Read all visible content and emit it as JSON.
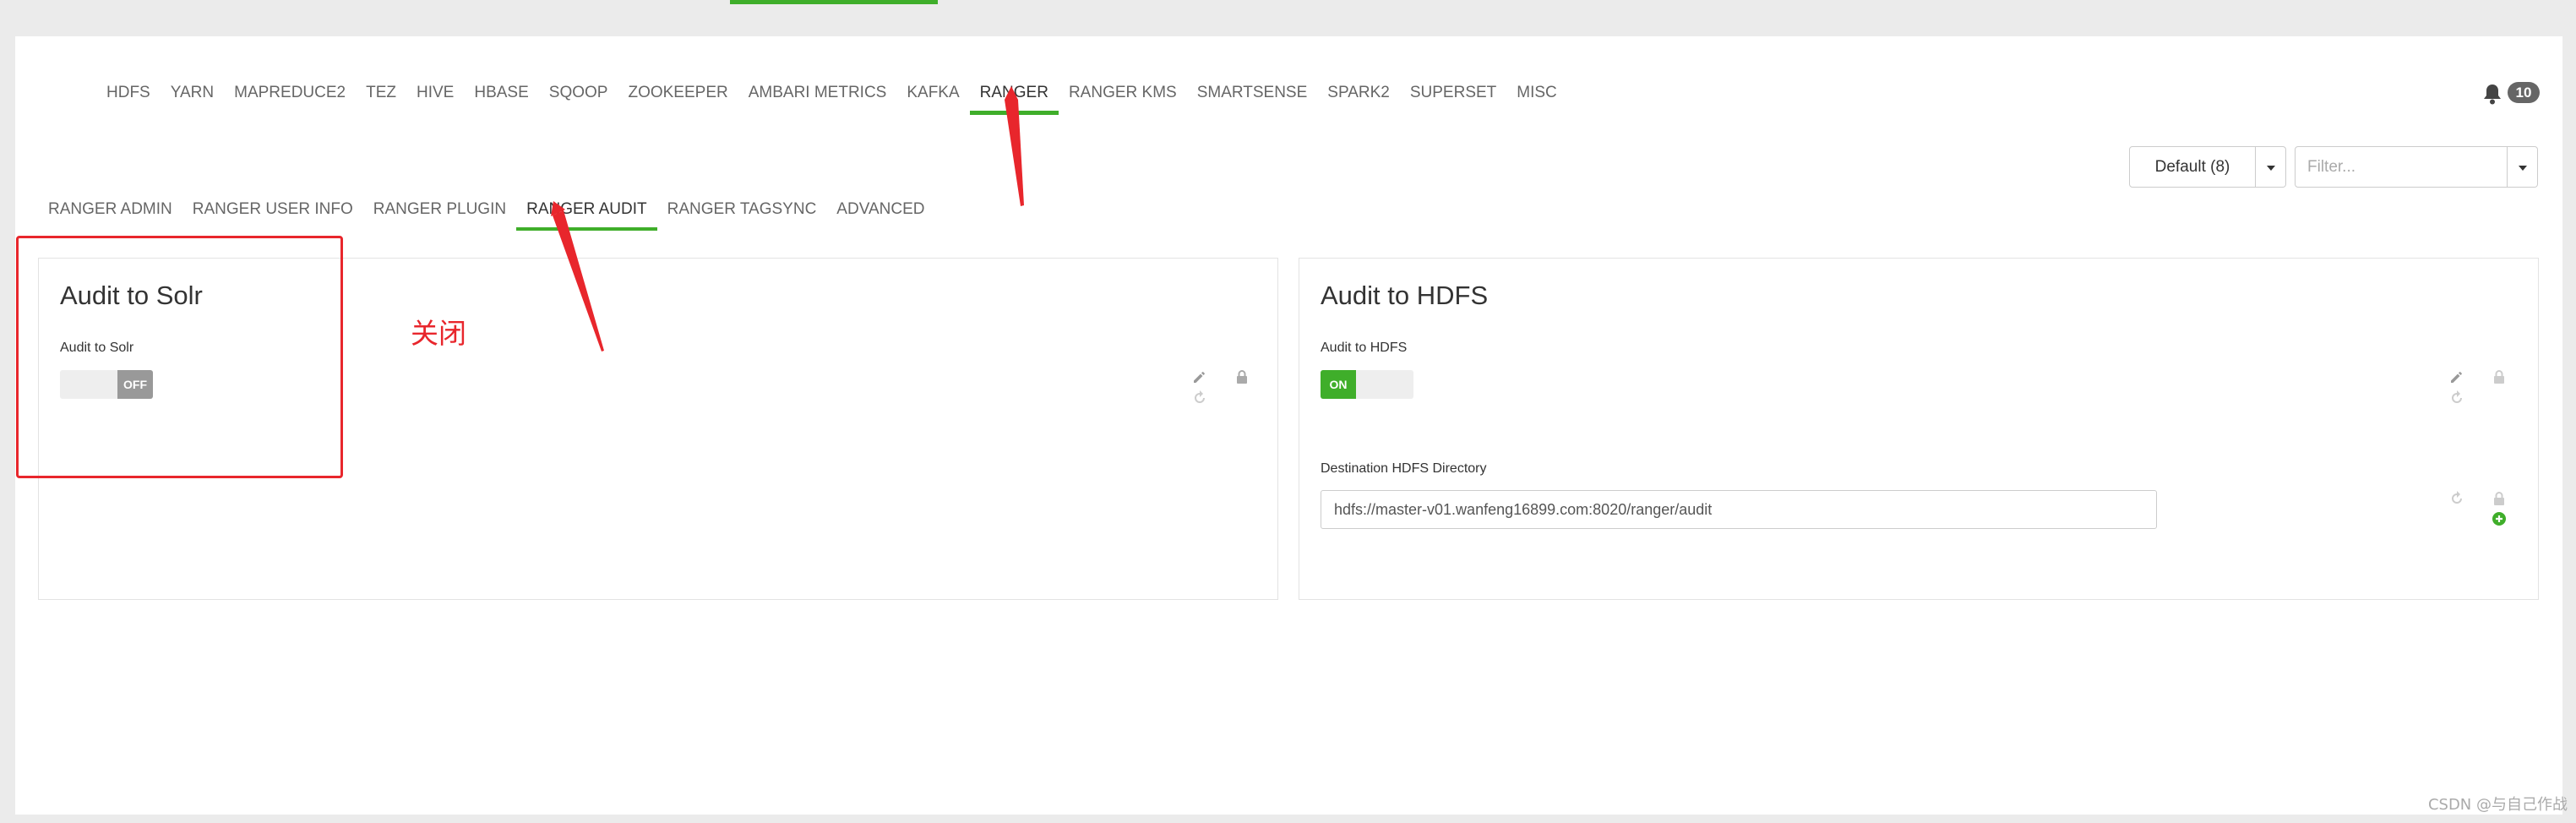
{
  "service_nav": [
    "HDFS",
    "YARN",
    "MAPREDUCE2",
    "TEZ",
    "HIVE",
    "HBASE",
    "SQOOP",
    "ZOOKEEPER",
    "AMBARI METRICS",
    "KAFKA",
    "RANGER",
    "RANGER KMS",
    "SMARTSENSE",
    "SPARK2",
    "SUPERSET",
    "MISC"
  ],
  "service_nav_active": "RANGER",
  "notifications": {
    "count": "10"
  },
  "config_group": {
    "label": "Default (8)"
  },
  "filter": {
    "placeholder": "Filter..."
  },
  "sub_nav": [
    "RANGER ADMIN",
    "RANGER USER INFO",
    "RANGER PLUGIN",
    "RANGER AUDIT",
    "RANGER TAGSYNC",
    "ADVANCED"
  ],
  "sub_nav_active": "RANGER AUDIT",
  "solr_panel": {
    "title": "Audit to Solr",
    "field_label": "Audit to Solr",
    "toggle_text": "OFF"
  },
  "hdfs_panel": {
    "title": "Audit to HDFS",
    "field_label": "Audit to HDFS",
    "toggle_text": "ON",
    "dir_label": "Destination HDFS Directory",
    "dir_value": "hdfs://master-v01.wanfeng16899.com:8020/ranger/audit"
  },
  "annotation": {
    "text": "关闭",
    "color": "#e8262c"
  },
  "watermark": "CSDN @与自己作战",
  "colors": {
    "accent": "#3fae2a",
    "annotation": "#e8262c",
    "toggle_off": "#999999"
  }
}
